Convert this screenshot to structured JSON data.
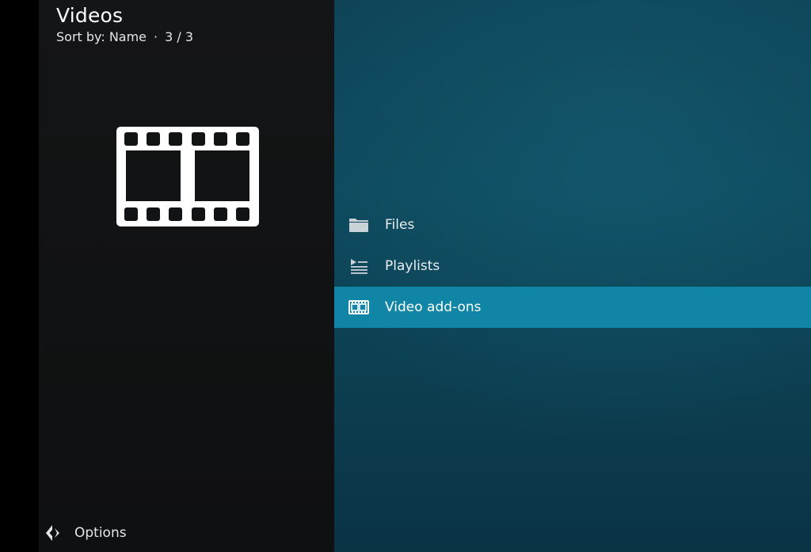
{
  "header": {
    "title": "Videos",
    "sort_label": "Sort by: Name",
    "separator": "·",
    "position": "3 / 3"
  },
  "thumbnail": {
    "icon": "film-strip-icon",
    "color": "#ffffff"
  },
  "menu": {
    "items": [
      {
        "label": "Files",
        "icon": "folder-icon",
        "focused": false
      },
      {
        "label": "Playlists",
        "icon": "playlist-icon",
        "focused": false
      },
      {
        "label": "Video add-ons",
        "icon": "film-icon",
        "focused": true
      }
    ]
  },
  "footer": {
    "options_label": "Options",
    "options_icon": "options-arrows-icon"
  },
  "colors": {
    "accent": "#1185a6",
    "background": "#0e4a5e",
    "panel": "#121314",
    "text": "#e9eef0"
  }
}
